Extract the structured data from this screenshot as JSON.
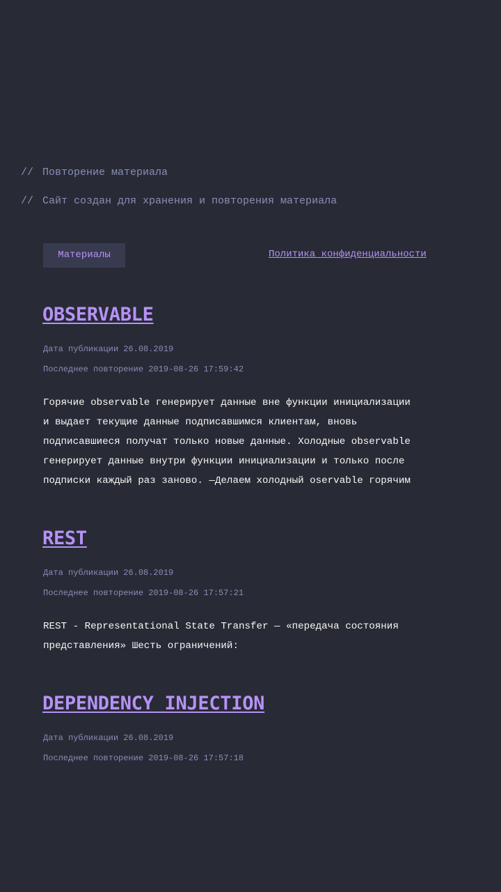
{
  "header": {
    "prefix": "//",
    "title": "Повторение материала",
    "subtitle": "Сайт создан для хранения и повторения материала"
  },
  "nav": {
    "materials_label": "Материалы",
    "privacy_label": "Политика конфиденциальности"
  },
  "posts": [
    {
      "title": "OBSERVABLE",
      "published": "Дата публикации 26.08.2019",
      "repeated": "Последнее повторение 2019-08-26 17:59:42",
      "excerpt": [
        "Горячие observable генерирует данные вне функции инициализации",
        "и выдает текущие данные подписавшимся клиентам, вновь",
        "подписавшиеся получат только новые данные. Холодные observable",
        "генерирует данные внутри функции инициализации и только после",
        "подписки каждый раз заново. —Делаем холодный oservable горячим"
      ]
    },
    {
      "title": "REST",
      "published": "Дата публикации 26.08.2019",
      "repeated": "Последнее повторение 2019-08-26 17:57:21",
      "excerpt": [
        "REST - Representational State Transfer — «передача состояния",
        "представления» Шесть ограничений:"
      ]
    },
    {
      "title": "DEPENDENCY INJECTION",
      "published": "Дата публикации 26.08.2019",
      "repeated": "Последнее повторение 2019-08-26 17:57:18"
    }
  ]
}
